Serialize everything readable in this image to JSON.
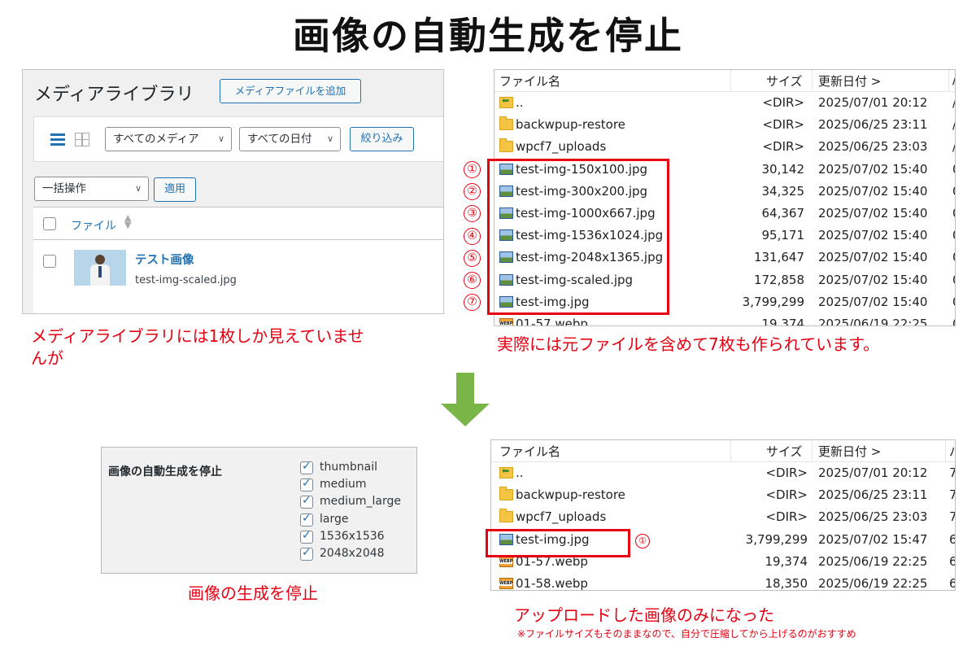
{
  "title": "画像の自動生成を停止",
  "media_library": {
    "title": "メディアライブラリ",
    "add_button": "メディアファイルを追加",
    "filter_media": "すべてのメディア",
    "filter_date": "すべての日付",
    "filter_button": "絞り込み",
    "bulk_action": "一括操作",
    "apply_button": "適用",
    "column_file": "ファイル",
    "item_title": "テスト画像",
    "item_filename": "test-img-scaled.jpg"
  },
  "captions": {
    "left_top_line1": "メディアライブラリには1枚しか見えていませ",
    "left_top_line2": "んが",
    "right_top": "実際には元ファイルを含めて7枚も作られています。",
    "bottom_left": "画像の生成を停止",
    "bottom_right": "アップロードした画像のみになった",
    "bottom_note": "※ファイルサイズもそのままなので、自分で圧縮してから上げるのがおすすめ"
  },
  "explorer_headers": {
    "name": "ファイル名",
    "size": "サイズ",
    "date": "更新日付 >"
  },
  "explorer_top": {
    "extra_header": "/",
    "rows": [
      {
        "icon": "up-folder",
        "name": "..",
        "size": "<DIR>",
        "date": "2025/07/01 20:12",
        "extra": "/"
      },
      {
        "icon": "folder",
        "name": "backwpup-restore",
        "size": "<DIR>",
        "date": "2025/06/25 23:11",
        "extra": "/"
      },
      {
        "icon": "folder",
        "name": "wpcf7_uploads",
        "size": "<DIR>",
        "date": "2025/06/25 23:03",
        "extra": "/"
      },
      {
        "icon": "image",
        "name": "test-img-150x100.jpg",
        "size": "30,142",
        "date": "2025/07/02 15:40",
        "extra": "0"
      },
      {
        "icon": "image",
        "name": "test-img-300x200.jpg",
        "size": "34,325",
        "date": "2025/07/02 15:40",
        "extra": "0"
      },
      {
        "icon": "image",
        "name": "test-img-1000x667.jpg",
        "size": "64,367",
        "date": "2025/07/02 15:40",
        "extra": "0"
      },
      {
        "icon": "image",
        "name": "test-img-1536x1024.jpg",
        "size": "95,171",
        "date": "2025/07/02 15:40",
        "extra": "0"
      },
      {
        "icon": "image",
        "name": "test-img-2048x1365.jpg",
        "size": "131,647",
        "date": "2025/07/02 15:40",
        "extra": "0"
      },
      {
        "icon": "image",
        "name": "test-img-scaled.jpg",
        "size": "172,858",
        "date": "2025/07/02 15:40",
        "extra": "0"
      },
      {
        "icon": "image",
        "name": "test-img.jpg",
        "size": "3,799,299",
        "date": "2025/07/02 15:40",
        "extra": "0"
      },
      {
        "icon": "webp",
        "name": "01-57.webp",
        "size": "19,374",
        "date": "2025/06/19 22:25",
        "extra": "0"
      }
    ],
    "numbers": [
      "①",
      "②",
      "③",
      "④",
      "⑤",
      "⑥",
      "⑦"
    ]
  },
  "explorer_bottom": {
    "extra_header": "パ",
    "rows": [
      {
        "icon": "up-folder",
        "name": "..",
        "size": "<DIR>",
        "date": "2025/07/01 20:12",
        "extra": "7"
      },
      {
        "icon": "folder",
        "name": "backwpup-restore",
        "size": "<DIR>",
        "date": "2025/06/25 23:11",
        "extra": "7"
      },
      {
        "icon": "folder",
        "name": "wpcf7_uploads",
        "size": "<DIR>",
        "date": "2025/06/25 23:03",
        "extra": "7"
      },
      {
        "icon": "image",
        "name": "test-img.jpg",
        "size": "3,799,299",
        "date": "2025/07/02 15:47",
        "extra": "6"
      },
      {
        "icon": "webp",
        "name": "01-57.webp",
        "size": "19,374",
        "date": "2025/06/19 22:25",
        "extra": "6"
      },
      {
        "icon": "webp",
        "name": "01-58.webp",
        "size": "18,350",
        "date": "2025/06/19 22:25",
        "extra": "6"
      }
    ],
    "number": "①"
  },
  "settings": {
    "label": "画像の自動生成を停止",
    "options": [
      {
        "label": "thumbnail",
        "checked": true
      },
      {
        "label": "medium",
        "checked": true
      },
      {
        "label": "medium_large",
        "checked": true
      },
      {
        "label": "large",
        "checked": true
      },
      {
        "label": "1536x1536",
        "checked": true
      },
      {
        "label": "2048x2048",
        "checked": true
      }
    ]
  },
  "colors": {
    "accent_red": "#e60012",
    "wp_blue": "#2271b1",
    "arrow_green": "#7ab647"
  }
}
